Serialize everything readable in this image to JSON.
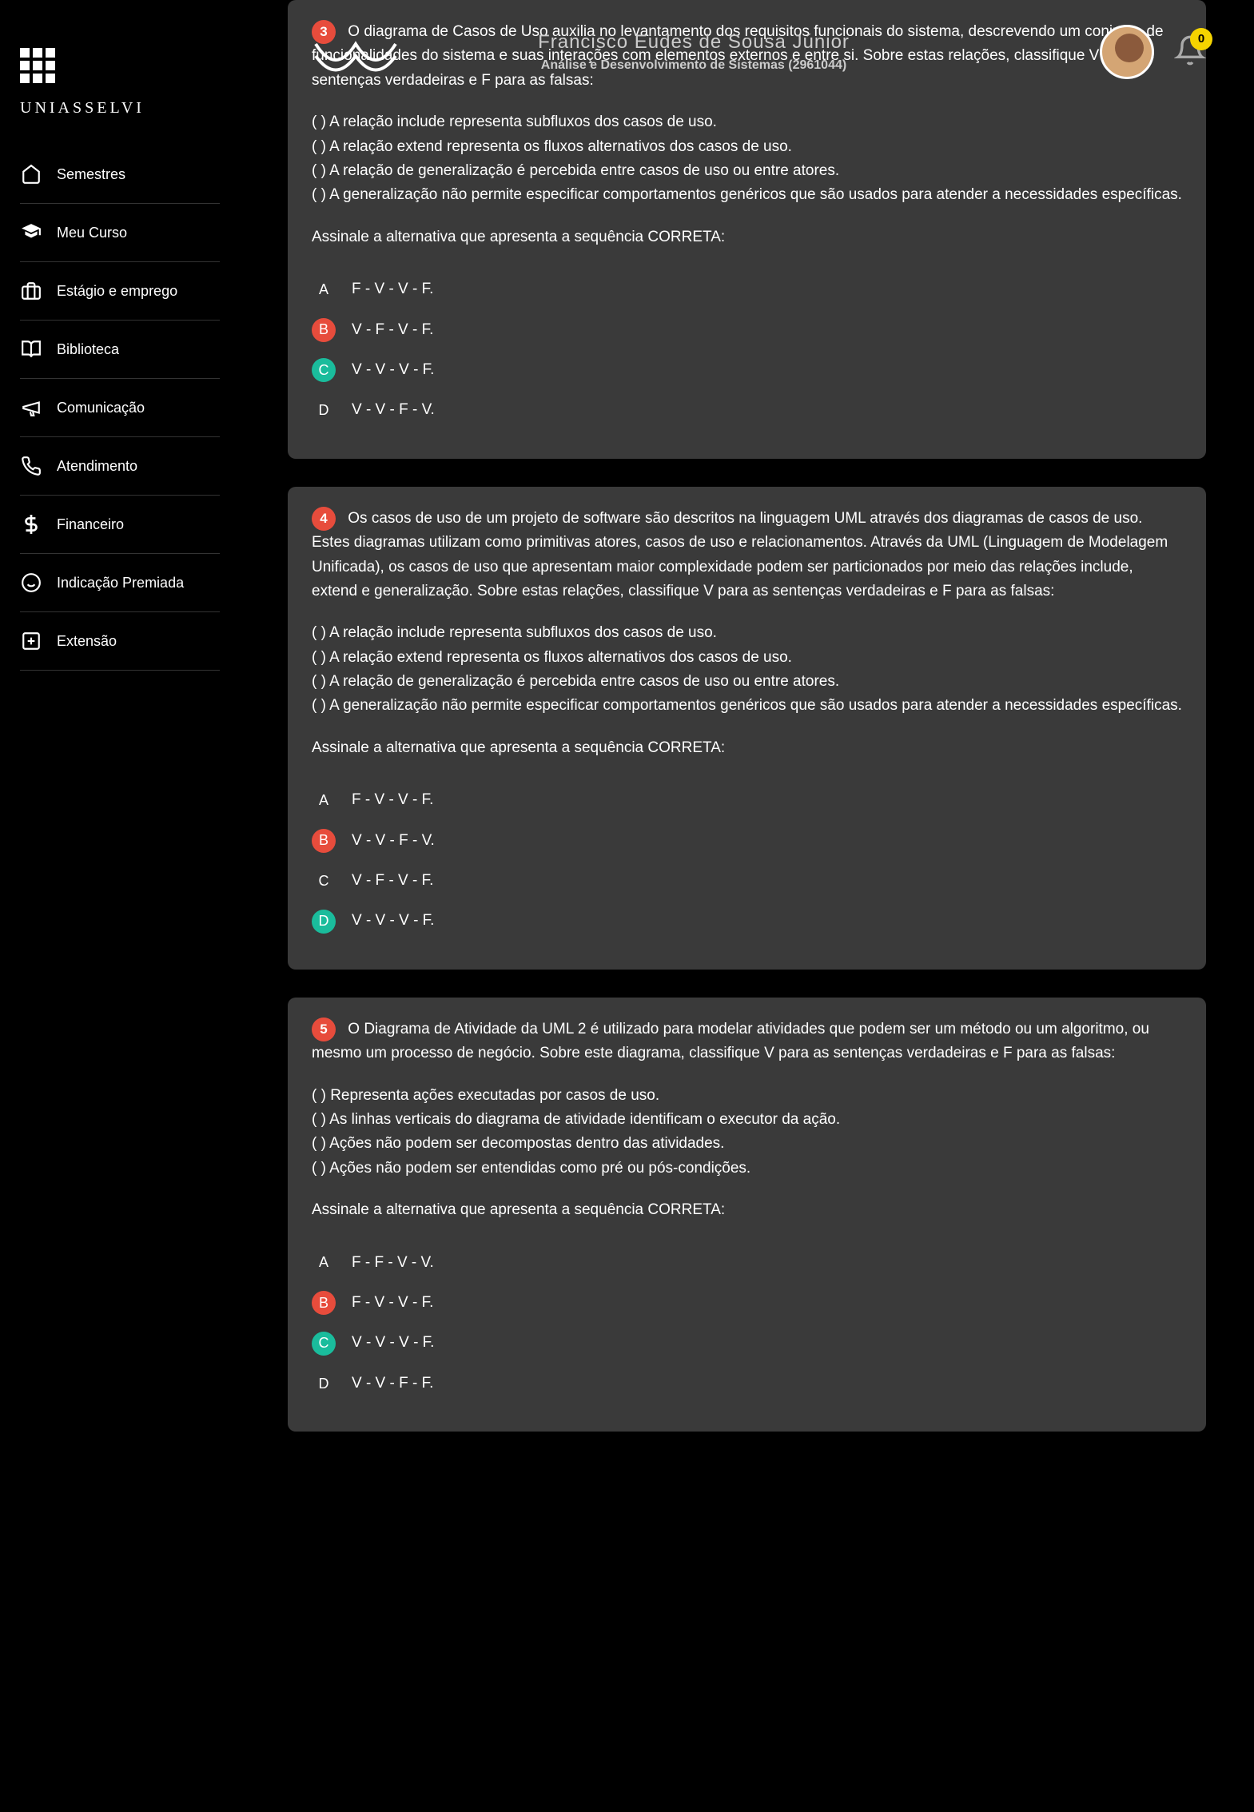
{
  "brand": "UNIASSELVI",
  "sidebar": {
    "items": [
      {
        "label": "Semestres"
      },
      {
        "label": "Meu Curso"
      },
      {
        "label": "Estágio e emprego"
      },
      {
        "label": "Biblioteca"
      },
      {
        "label": "Comunicação"
      },
      {
        "label": "Atendimento"
      },
      {
        "label": "Financeiro"
      },
      {
        "label": "Indicação Premiada"
      },
      {
        "label": "Extensão"
      }
    ]
  },
  "header": {
    "user": "Francisco Eudes de Sousa Júnior",
    "course": "Análise e Desenvolvimento de Sistemas (2961044)",
    "notifications": "0"
  },
  "questions": [
    {
      "num": "3",
      "intro": "O diagrama de Casos de Uso auxilia no levantamento dos requisitos funcionais do sistema, descrevendo um conjunto de funcionalidades do sistema e suas interações com elementos externos e entre si. Sobre estas relações, classifique V para as sentenças verdadeiras e F para as falsas:",
      "items": [
        "(    ) A relação include representa subfluxos dos casos de uso.",
        "(    ) A relação extend representa os fluxos alternativos dos casos de uso.",
        "(    ) A relação de generalização é percebida entre casos de uso ou entre atores.",
        "(    ) A generalização não permite especificar comportamentos genéricos que são usados para atender a necessidades específicas."
      ],
      "prompt": "Assinale a alternativa que apresenta a sequência CORRETA:",
      "options": [
        {
          "letter": "A",
          "text": "F - V - V - F.",
          "state": ""
        },
        {
          "letter": "B",
          "text": "V - F - V - F.",
          "state": "selected"
        },
        {
          "letter": "C",
          "text": "V - V - V - F.",
          "state": "correct"
        },
        {
          "letter": "D",
          "text": "V - V - F - V.",
          "state": ""
        }
      ]
    },
    {
      "num": "4",
      "intro": "Os casos de uso de um projeto de software são descritos na linguagem UML através dos diagramas de casos de uso. Estes diagramas utilizam como primitivas atores, casos de uso e relacionamentos. Através da UML (Linguagem de Modelagem Unificada), os casos de uso que apresentam maior complexidade podem ser particionados por meio das relações include, extend e generalização. Sobre estas relações, classifique V para as sentenças verdadeiras e F para as falsas:",
      "items": [
        "(    ) A relação include representa subfluxos dos casos de uso.",
        "(    ) A relação extend representa os fluxos alternativos dos casos de uso.",
        "(    ) A relação de generalização é percebida entre casos de uso ou entre atores.",
        "(    ) A generalização não permite especificar comportamentos genéricos que são usados para atender a necessidades específicas."
      ],
      "prompt": "Assinale a alternativa que apresenta a sequência CORRETA:",
      "options": [
        {
          "letter": "A",
          "text": "F - V - V - F.",
          "state": ""
        },
        {
          "letter": "B",
          "text": "V - V - F - V.",
          "state": "selected"
        },
        {
          "letter": "C",
          "text": "V - F - V - F.",
          "state": ""
        },
        {
          "letter": "D",
          "text": "V - V - V - F.",
          "state": "correct"
        }
      ]
    },
    {
      "num": "5",
      "intro": "O Diagrama de Atividade da UML 2 é utilizado para modelar atividades que podem ser um método ou um algoritmo, ou mesmo um processo de negócio. Sobre este diagrama, classifique V para as sentenças verdadeiras e F para as falsas:",
      "items": [
        "(    ) Representa ações executadas por casos de uso.",
        "(    ) As linhas verticais do diagrama de atividade identificam o executor da ação.",
        "(    ) Ações não podem ser decompostas dentro das atividades.",
        "(    ) Ações não podem ser entendidas como pré ou pós-condições."
      ],
      "prompt": "Assinale a alternativa que apresenta a sequência CORRETA:",
      "options": [
        {
          "letter": "A",
          "text": "F - F - V - V.",
          "state": ""
        },
        {
          "letter": "B",
          "text": "F - V - V - F.",
          "state": "selected"
        },
        {
          "letter": "C",
          "text": "V - V - V - F.",
          "state": "correct"
        },
        {
          "letter": "D",
          "text": "V - V - F - F.",
          "state": ""
        }
      ]
    }
  ]
}
